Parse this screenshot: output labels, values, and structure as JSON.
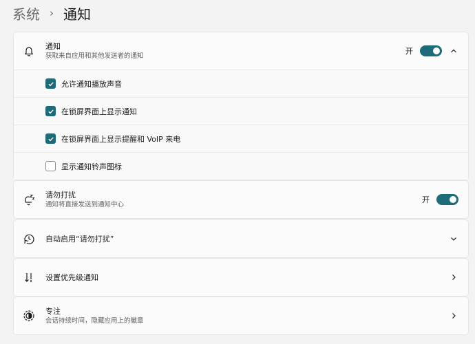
{
  "breadcrumb": {
    "parent": "系统",
    "separator": "›",
    "current": "通知"
  },
  "notifications": {
    "title": "通知",
    "description": "获取来自应用和其他发送者的通知",
    "state": "开",
    "enabled": true,
    "expanded": true,
    "icon": "bell-icon",
    "options": [
      {
        "label": "允许通知播放声音",
        "checked": true
      },
      {
        "label": "在锁屏界面上显示通知",
        "checked": true
      },
      {
        "label": "在锁屏界面上显示提醒和 VoIP 来电",
        "checked": true
      },
      {
        "label": "显示通知铃声图标",
        "checked": false
      }
    ]
  },
  "do_not_disturb": {
    "title": "请勿打扰",
    "description": "通知将直接发送到通知中心",
    "state": "开",
    "enabled": true,
    "icon": "dnd-bell-icon"
  },
  "auto_dnd": {
    "title": "自动启用“请勿打扰”",
    "icon": "clock-icon"
  },
  "priority": {
    "title": "设置优先级通知",
    "icon": "sort-arrows-icon"
  },
  "focus": {
    "title": "专注",
    "description": "会话持续时间，隐藏应用上的徽章",
    "icon": "focus-icon"
  },
  "colors": {
    "accent": "#1d6a78",
    "background": "#f3f3f3",
    "card": "#fbfbfb"
  }
}
